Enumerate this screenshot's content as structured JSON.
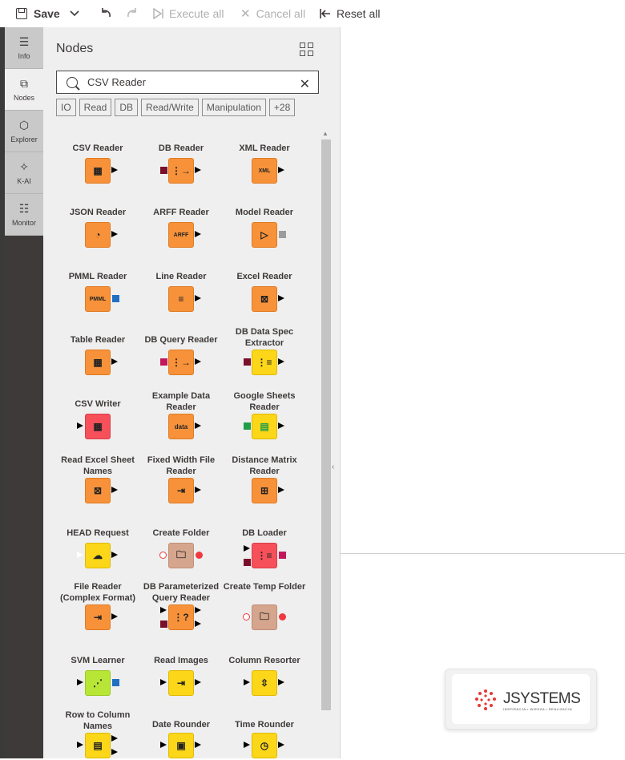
{
  "toolbar": {
    "save": "Save",
    "execute_all": "Execute all",
    "cancel_all": "Cancel all",
    "reset_all": "Reset all"
  },
  "sidenav": [
    {
      "label": "Info",
      "icon": "info-lines-icon",
      "active": false
    },
    {
      "label": "Nodes",
      "icon": "nodes-icon",
      "active": true
    },
    {
      "label": "Explorer",
      "icon": "cube-icon",
      "active": false
    },
    {
      "label": "K-AI",
      "icon": "ai-sparkle-icon",
      "active": false
    },
    {
      "label": "Monitor",
      "icon": "monitor-list-icon",
      "active": false
    }
  ],
  "panel": {
    "title": "Nodes",
    "search_value": "CSV Reader",
    "tags": [
      "IO",
      "Read",
      "DB",
      "Read/Write",
      "Manipulation",
      "+28"
    ]
  },
  "nodes": [
    {
      "label": "CSV Reader",
      "color": "#f7923a"
    },
    {
      "label": "DB Reader",
      "color": "#f7923a"
    },
    {
      "label": "XML Reader",
      "color": "#f7923a"
    },
    {
      "label": "JSON Reader",
      "color": "#f7923a"
    },
    {
      "label": "ARFF Reader",
      "color": "#f7923a"
    },
    {
      "label": "Model Reader",
      "color": "#f7923a"
    },
    {
      "label": "PMML Reader",
      "color": "#f7923a"
    },
    {
      "label": "Line Reader",
      "color": "#f7923a"
    },
    {
      "label": "Excel Reader",
      "color": "#f7923a"
    },
    {
      "label": "Table Reader",
      "color": "#f7923a"
    },
    {
      "label": "DB Query Reader",
      "color": "#f7923a"
    },
    {
      "label": "DB Data Spec Extractor",
      "color": "#fbd619"
    },
    {
      "label": "CSV Writer",
      "color": "#f6505a"
    },
    {
      "label": "Example Data Reader",
      "color": "#f7923a"
    },
    {
      "label": "Google Sheets Reader",
      "color": "#fbd619"
    },
    {
      "label": "Read Excel Sheet Names",
      "color": "#f7923a"
    },
    {
      "label": "Fixed Width File Reader",
      "color": "#f7923a"
    },
    {
      "label": "Distance Matrix Reader",
      "color": "#f7923a"
    },
    {
      "label": "HEAD Request",
      "color": "#fbd619"
    },
    {
      "label": "Create Folder",
      "color": "#d5a58d"
    },
    {
      "label": "DB Loader",
      "color": "#f6505a"
    },
    {
      "label": "File Reader (Complex Format)",
      "color": "#f7923a"
    },
    {
      "label": "DB Parameterized Query Reader",
      "color": "#f7923a"
    },
    {
      "label": "Create Temp Folder",
      "color": "#d5a58d"
    },
    {
      "label": "SVM Learner",
      "color": "#b8e637"
    },
    {
      "label": "Read Images",
      "color": "#fbd619"
    },
    {
      "label": "Column Resorter",
      "color": "#fbd619"
    },
    {
      "label": "Row to Column Names",
      "color": "#fbd619"
    },
    {
      "label": "Date Rounder",
      "color": "#fbd619"
    },
    {
      "label": "Time Rounder",
      "color": "#fbd619"
    }
  ],
  "logo": {
    "wordmark": "JSYSTEMS",
    "tagline": "INSPIRACJA • WIEDZA • REALIZACJA"
  }
}
